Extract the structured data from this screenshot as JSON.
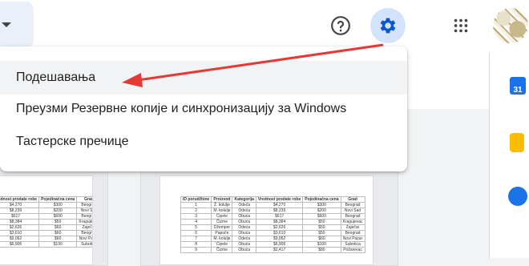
{
  "menu": {
    "items": [
      {
        "label": "Подешавања",
        "highlighted": true
      },
      {
        "label": "Преузми Резервне копије и синхронизацију за Windows",
        "highlighted": false
      },
      {
        "label": "Тастерске пречице",
        "highlighted": false
      }
    ]
  },
  "topbar": {
    "icons": [
      "help-icon",
      "gear-icon",
      "apps-grid-icon",
      "avatar"
    ]
  },
  "sidepanel": {
    "calendar_day": "31"
  },
  "colors": {
    "accent": "#1a73e8",
    "annotation_arrow": "#e53935",
    "gear_highlight_bg": "#d3e3fd"
  },
  "spreadsheet_preview": {
    "headers": [
      "ID porudžbine",
      "Proizvod",
      "Kategorija",
      "Vrednost prodate robe",
      "Pojedinačna cena",
      "Grad"
    ],
    "rows": [
      [
        "1",
        "Ž. kolulje",
        "Odeća",
        "$4,270",
        "$300",
        "Beograd"
      ],
      [
        "2",
        "M. kolulje",
        "Odeća",
        "$8,239",
        "$200",
        "Novi Sad"
      ],
      [
        "3",
        "Cipele",
        "Obuća",
        "$617",
        "$600",
        "Beograd"
      ],
      [
        "4",
        "Čizme",
        "Obuća",
        "$8,384",
        "$50",
        "Kragujevac"
      ],
      [
        "5",
        "Džemper",
        "Odeća",
        "$2,626",
        "$50",
        "Zaječar"
      ],
      [
        "6",
        "Papuče",
        "Obuća",
        "$3,610",
        "$50",
        "Beograd"
      ],
      [
        "7",
        "M. kolulje",
        "Odeća",
        "$9,062",
        "$60",
        "Novi Pazar"
      ],
      [
        "8",
        "Cipele",
        "Obuća",
        "$6,906",
        "$100",
        "Subotica"
      ],
      [
        "9",
        "Čizme",
        "Obuća",
        "$2,417",
        "$80",
        "Požarevac"
      ]
    ],
    "left_partial_headers": [
      "vrednost prodate robe",
      "Pojedinačna cena",
      "Grad"
    ],
    "left_partial_rows": [
      [
        "$4,270",
        "$300",
        "Beograd"
      ],
      [
        "$8,239",
        "$200",
        "Novi Sad"
      ],
      [
        "$617",
        "$600",
        "Beograd"
      ],
      [
        "$8,384",
        "$50",
        "Kragujevac"
      ],
      [
        "$2,626",
        "$60",
        "Zaječar"
      ],
      [
        "$3,610",
        "$60",
        "Beograd"
      ],
      [
        "$9,062",
        "$60",
        "Novi Pazar"
      ],
      [
        "$6,906",
        "$100",
        "Subotica"
      ]
    ]
  }
}
